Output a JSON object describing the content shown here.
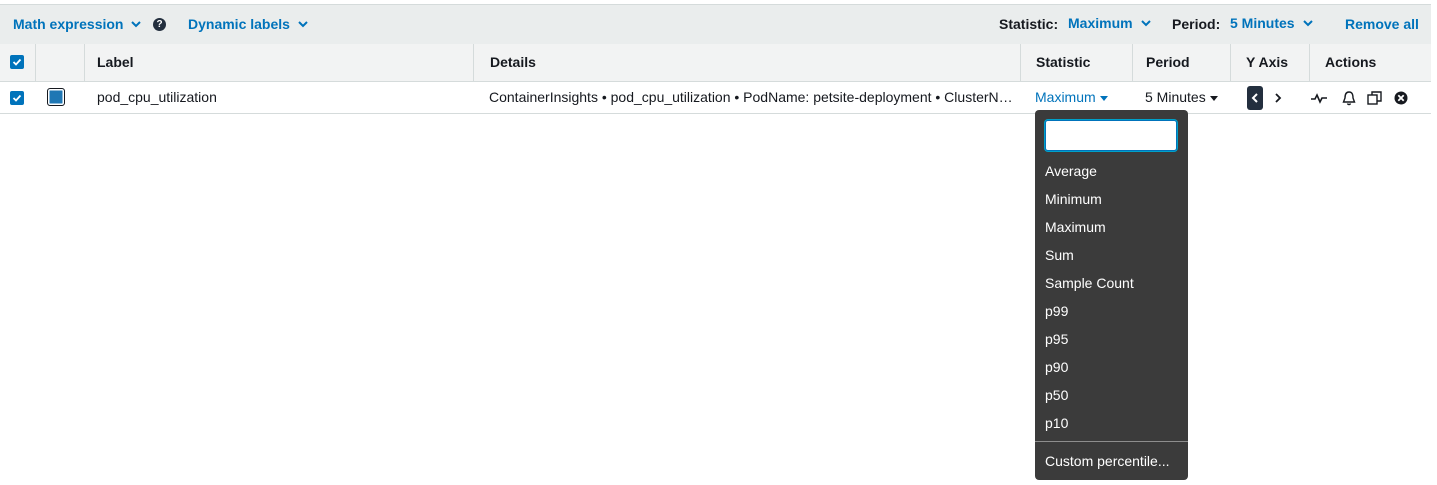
{
  "toolbar": {
    "math_expression": "Math expression",
    "help": "?",
    "dynamic_labels": "Dynamic labels",
    "statistic_label": "Statistic:",
    "statistic_value": "Maximum",
    "period_label": "Period:",
    "period_value": "5 Minutes",
    "remove_all": "Remove all"
  },
  "table": {
    "headers": {
      "label": "Label",
      "details": "Details",
      "statistic": "Statistic",
      "period": "Period",
      "yaxis": "Y Axis",
      "actions": "Actions"
    },
    "rows": [
      {
        "label": "pod_cpu_utilization",
        "details": "ContainerInsights • pod_cpu_utilization • PodName: petsite-deployment • ClusterName",
        "statistic": "Maximum",
        "period": "5 Minutes",
        "color": "#1f77b4"
      }
    ]
  },
  "statistic_dropdown": {
    "search_value": "",
    "options": [
      "Average",
      "Minimum",
      "Maximum",
      "Sum",
      "Sample Count",
      "p99",
      "p95",
      "p90",
      "p50",
      "p10"
    ],
    "custom": "Custom percentile..."
  },
  "colors": {
    "link": "#0073bb",
    "toolbar_bg": "#eaeded",
    "dropdown_bg": "#3b3b3b"
  }
}
